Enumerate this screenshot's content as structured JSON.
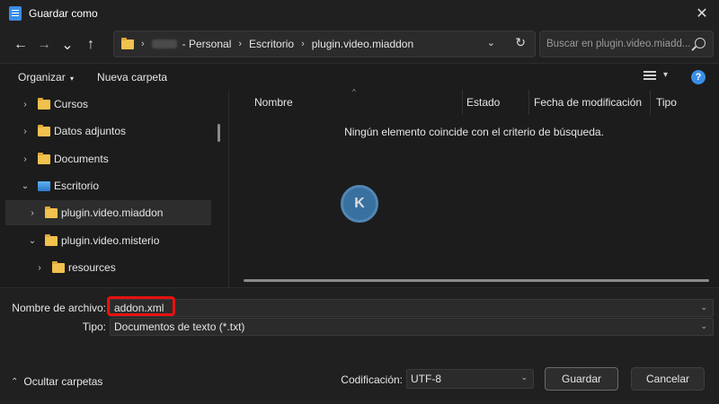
{
  "window": {
    "title": "Guardar como",
    "close_glyph": "✕"
  },
  "nav": {
    "back_glyph": "←",
    "forward_glyph": "→",
    "recent_glyph": "⌄",
    "up_glyph": "↑"
  },
  "address": {
    "sep": "›",
    "crumbs": [
      "- Personal",
      "Escritorio",
      "plugin.video.miaddon"
    ],
    "dropdown_glyph": "⌄",
    "refresh_glyph": "↻"
  },
  "search": {
    "placeholder": "Buscar en plugin.video.miadd..."
  },
  "toolbar": {
    "organize_label": "Organizar",
    "organize_dd": "▾",
    "new_folder_label": "Nueva carpeta",
    "view_dd": "▾",
    "help_glyph": "?"
  },
  "sidebar": {
    "items": [
      {
        "label": "Cursos",
        "chevron": "›"
      },
      {
        "label": "Datos adjuntos",
        "chevron": "›"
      },
      {
        "label": "Documents",
        "chevron": "›"
      },
      {
        "label": "Escritorio",
        "chevron": "⌄"
      },
      {
        "label": "plugin.video.miaddon",
        "chevron": "›"
      },
      {
        "label": "plugin.video.misterio",
        "chevron": "⌄"
      },
      {
        "label": "resources",
        "chevron": "›"
      }
    ]
  },
  "content": {
    "columns": [
      "Nombre",
      "Estado",
      "Fecha de modificación",
      "Tipo"
    ],
    "sort_glyph": "^",
    "empty_message": "Ningún elemento coincide con el criterio de búsqueda.",
    "watermark_letter": "K"
  },
  "form": {
    "filename_label": "Nombre de archivo:",
    "filename_value": "addon.xml",
    "type_label": "Tipo:",
    "type_value": "Documentos de texto (*.txt)",
    "encoding_label": "Codificación:",
    "encoding_value": "UTF-8",
    "dd_glyph": "⌄",
    "hide_folders_glyph": "⌃",
    "hide_folders_label": "Ocultar carpetas",
    "save_label": "Guardar",
    "cancel_label": "Cancelar"
  },
  "colors": {
    "background": "#1c1c1c",
    "accent": "#3a8ee6",
    "folder": "#f2c14e",
    "highlight": "#e81010"
  }
}
